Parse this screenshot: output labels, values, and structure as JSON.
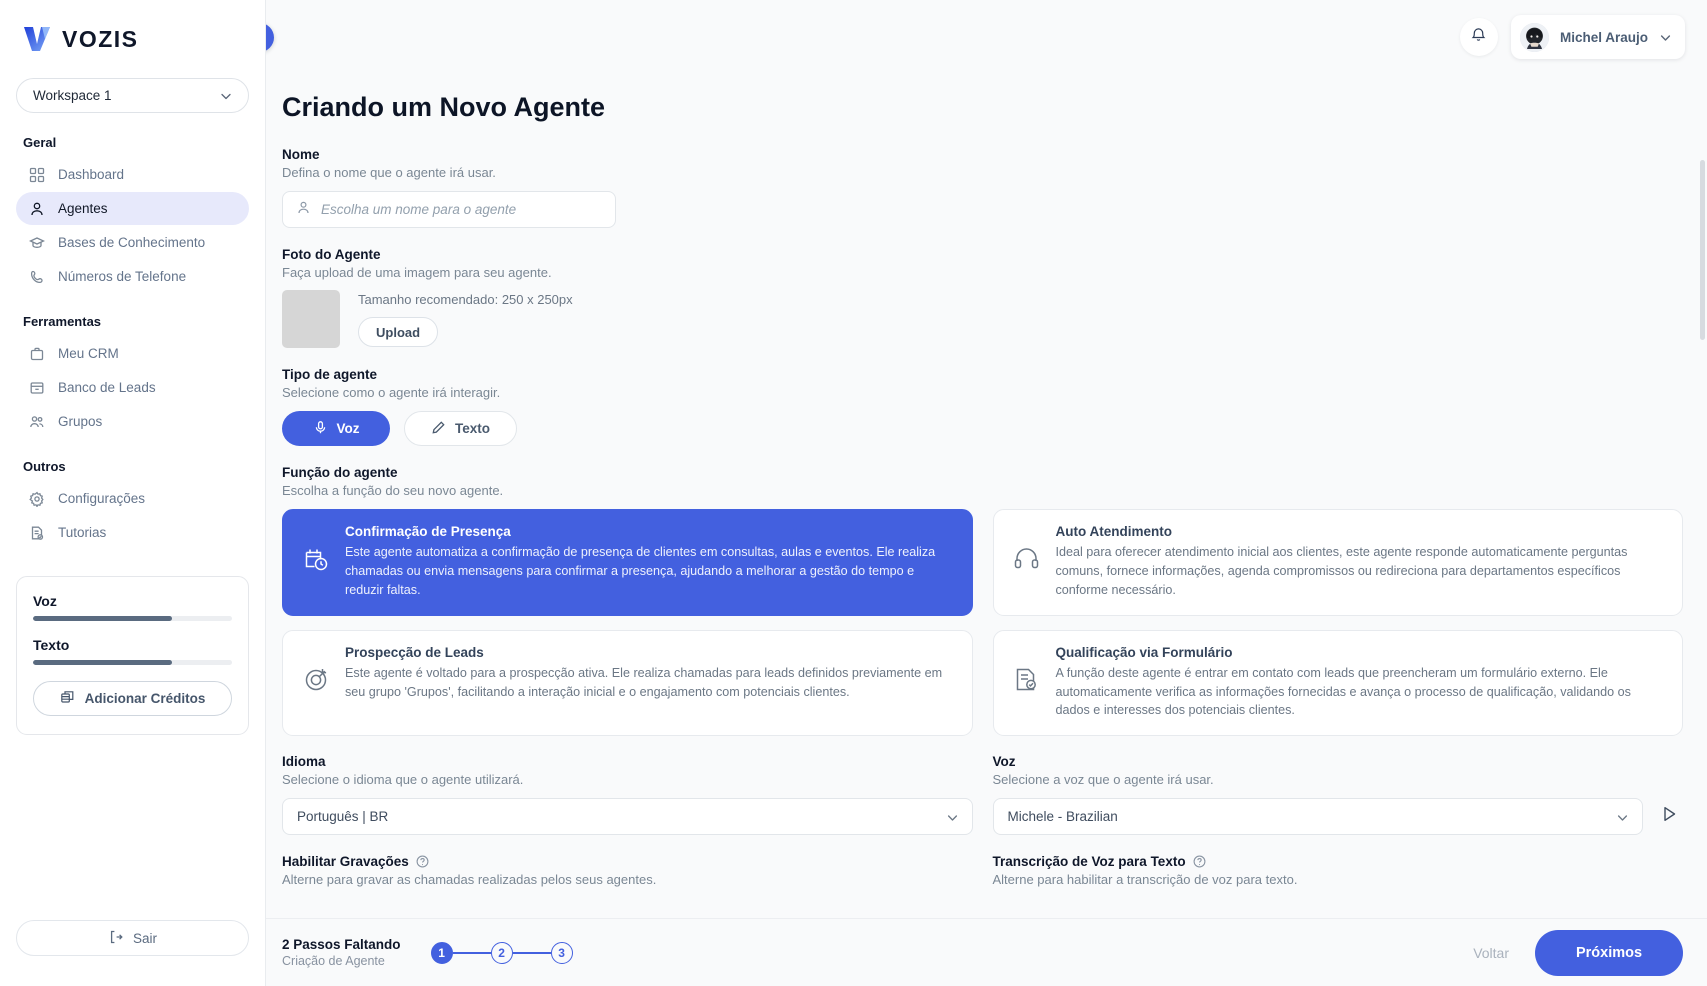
{
  "brand": {
    "name": "VOZIS",
    "accent": "#4360df"
  },
  "sidebar": {
    "workspace": {
      "label": "Workspace 1"
    },
    "groups": [
      {
        "title": "Geral",
        "items": [
          {
            "label": "Dashboard",
            "icon": "grid-icon",
            "active": false
          },
          {
            "label": "Agentes",
            "icon": "user-icon",
            "active": true
          },
          {
            "label": "Bases de Conhecimento",
            "icon": "graduation-cap-icon",
            "active": false
          },
          {
            "label": "Números de Telefone",
            "icon": "phone-icon",
            "active": false
          }
        ]
      },
      {
        "title": "Ferramentas",
        "items": [
          {
            "label": "Meu CRM",
            "icon": "briefcase-icon",
            "active": false
          },
          {
            "label": "Banco de Leads",
            "icon": "archive-icon",
            "active": false
          },
          {
            "label": "Grupos",
            "icon": "users-icon",
            "active": false
          }
        ]
      },
      {
        "title": "Outros",
        "items": [
          {
            "label": "Configurações",
            "icon": "gear-icon",
            "active": false
          },
          {
            "label": "Tutorias",
            "icon": "document-check-icon",
            "active": false
          }
        ]
      }
    ],
    "credits": {
      "voice_label": "Voz",
      "voice_percent": 70,
      "text_label": "Texto",
      "text_percent": 70,
      "add_button": "Adicionar Créditos"
    },
    "logout": "Sair"
  },
  "topbar": {
    "notifications_icon": "bell-icon",
    "user": {
      "name": "Michel Araujo"
    },
    "collapse_icon": "chevron-left-icon"
  },
  "main": {
    "title": "Criando um Novo Agente",
    "name": {
      "label": "Nome",
      "sub": "Defina o nome que o agente irá usar.",
      "placeholder": "Escolha um nome para o agente",
      "value": ""
    },
    "photo": {
      "label": "Foto do Agente",
      "sub": "Faça upload de uma imagem para seu agente.",
      "hint": "Tamanho recomendado: 250 x 250px",
      "upload_button": "Upload"
    },
    "agent_type": {
      "label": "Tipo de agente",
      "sub": "Selecione como o agente irá interagir.",
      "options": [
        {
          "label": "Voz",
          "icon": "microphone-icon",
          "selected": true
        },
        {
          "label": "Texto",
          "icon": "pencil-icon",
          "selected": false
        }
      ]
    },
    "agent_function": {
      "label": "Função do agente",
      "sub": "Escolha a função do seu novo agente.",
      "cards": [
        {
          "title": "Confirmação de Presença",
          "icon": "calendar-clock-icon",
          "selected": true,
          "desc": "Este agente automatiza a confirmação de presença de clientes em consultas, aulas e eventos. Ele realiza chamadas ou envia mensagens para confirmar a presença, ajudando a melhorar a gestão do tempo e reduzir faltas."
        },
        {
          "title": "Auto Atendimento",
          "icon": "headset-icon",
          "selected": false,
          "desc": "Ideal para oferecer atendimento inicial aos clientes, este agente responde automaticamente perguntas comuns, fornece informações, agenda compromissos ou redireciona para departamentos específicos conforme necessário."
        },
        {
          "title": "Prospecção de Leads",
          "icon": "target-icon",
          "selected": false,
          "desc": "Este agente é voltado para a prospecção ativa. Ele realiza chamadas para leads definidos previamente em seu grupo 'Grupos', facilitando a interação inicial e o engajamento com potenciais clientes."
        },
        {
          "title": "Qualificação via Formulário",
          "icon": "form-check-icon",
          "selected": false,
          "desc": "A função deste agente é entrar em contato com leads que preencheram um formulário externo. Ele automaticamente verifica as informações fornecidas e avança o processo de qualificação, validando os dados e interesses dos potenciais clientes."
        }
      ]
    },
    "language": {
      "label": "Idioma",
      "sub": "Selecione o idioma que o agente utilizará.",
      "value": "Português | BR"
    },
    "voice": {
      "label": "Voz",
      "sub": "Selecione a voz que o agente irá usar.",
      "value": "Michele - Brazilian",
      "play_icon": "play-icon"
    },
    "recordings": {
      "label": "Habilitar Gravações",
      "help_icon": "help-circle-icon",
      "sub": "Alterne para gravar as chamadas realizadas pelos seus agentes."
    },
    "transcription": {
      "label": "Transcrição de Voz para Texto",
      "help_icon": "help-circle-icon",
      "sub": "Alterne para habilitar a transcrição de voz para texto."
    }
  },
  "footer": {
    "steps_title": "2 Passos Faltando",
    "steps_sub": "Criação de Agente",
    "steps": [
      "1",
      "2",
      "3"
    ],
    "current_step": 1,
    "back_label": "Voltar",
    "next_label": "Próximos"
  }
}
